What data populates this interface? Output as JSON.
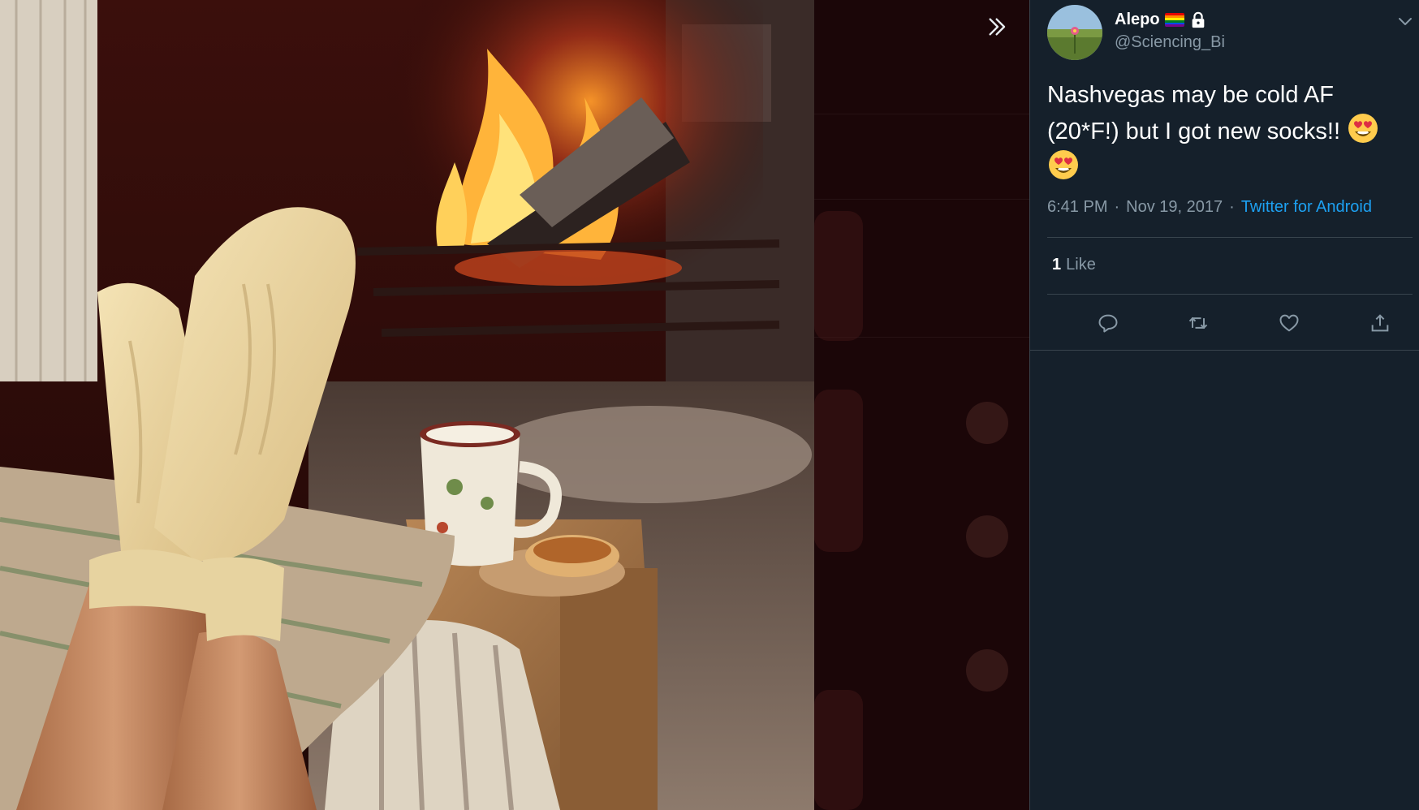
{
  "tweet": {
    "author": {
      "display_name": "Alepo",
      "handle": "@Sciencing_Bi",
      "badges": [
        "rainbow-flag-icon",
        "lock-icon"
      ]
    },
    "text_line1": "Nashvegas may be cold AF",
    "text_line2": "(20*F!) but I got new socks!!",
    "emoji": "smiling-face-with-heart-eyes",
    "time": "6:41 PM",
    "date": "Nov 19, 2017",
    "separator": "·",
    "source": "Twitter for Android",
    "like_count": "1",
    "like_label": "Like"
  },
  "actions": [
    "reply-icon",
    "retweet-icon",
    "like-icon",
    "share-icon"
  ],
  "viewer": {
    "collapse_icon": "chevron-double-right-icon"
  },
  "colors": {
    "panel_bg": "#15202b",
    "divider": "#38444d",
    "muted_text": "#8899a6",
    "link": "#1da1f2"
  }
}
